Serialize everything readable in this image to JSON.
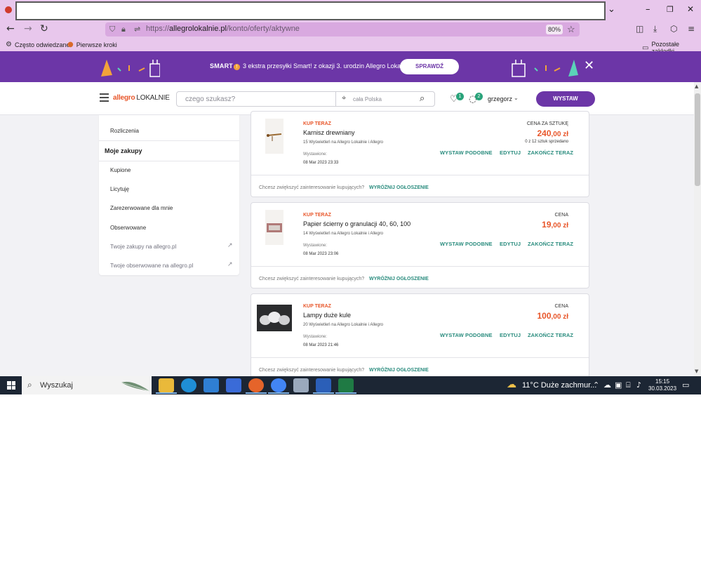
{
  "browser": {
    "url_prefix": "https://",
    "url_domain": "allegrolokalnie.pl",
    "url_path": "/konto/oferty/aktywne",
    "zoom": "80%",
    "bookmarks": [
      "Często odwiedzane",
      "Pierwsze kroki"
    ],
    "other_bookmarks": "Pozostałe zakładki",
    "window_controls": {
      "chevron": "⌄",
      "minimize": "–",
      "restore": "❐",
      "close": "✕"
    }
  },
  "promo": {
    "smart": "SMART",
    "excl": "!",
    "text": "3 ekstra przesyłki Smart! z okazji 3. urodzin Allegro Lokalnie!",
    "button": "SPRAWDŹ",
    "close": "✕"
  },
  "header": {
    "logo_allegro": "allegro",
    "logo_lokalnie": "LOKALNIE",
    "search_placeholder": "czego szukasz?",
    "location_placeholder": "cała Polska",
    "favorites_count": "1",
    "messages_count": "2",
    "username": "grzegorz",
    "sell_button": "WYSTAW"
  },
  "sidebar": {
    "items": [
      {
        "label": "Rozliczenia"
      },
      {
        "label": "Moje zakupy"
      },
      {
        "label": "Kupione"
      },
      {
        "label": "Licytuję"
      },
      {
        "label": "Zarezerwowane dla mnie"
      },
      {
        "label": "Obserwowane"
      },
      {
        "label": "Twoje zakupy na allegro.pl"
      },
      {
        "label": "Twoje obserwowane na allegro.pl"
      }
    ]
  },
  "offers": [
    {
      "type": "KUP TERAZ",
      "title": "Karnisz drewniany",
      "views": "15 Wyświetleń na Allegro Lokalnie i Allegro",
      "listed_label": "Wystawione:",
      "listed_date": "08 Mar 2023 23:33",
      "price_label": "CENA ZA SZTUKĘ",
      "price_int": "240",
      "price_dec": ",00",
      "currency": " zł",
      "sold": "0 z 12 sztuk sprzedano",
      "actions": [
        "WYSTAW PODOBNE",
        "EDYTUJ",
        "ZAKOŃCZ TERAZ"
      ],
      "promo_question": "Chcesz zwiększyć zainteresowanie kupujących?",
      "promo_link": "WYRÓŻNIJ OGŁOSZENIE"
    },
    {
      "type": "KUP TERAZ",
      "title": "Papier ścierny o granulacji 40, 60, 100",
      "views": "14 Wyświetleń na Allegro Lokalnie i Allegro",
      "listed_label": "Wystawione:",
      "listed_date": "08 Mar 2023 23:06",
      "price_label": "CENA",
      "price_int": "19",
      "price_dec": ",00",
      "currency": " zł",
      "actions": [
        "WYSTAW PODOBNE",
        "EDYTUJ",
        "ZAKOŃCZ TERAZ"
      ],
      "promo_question": "Chcesz zwiększyć zainteresowanie kupujących?",
      "promo_link": "WYRÓŻNIJ OGŁOSZENIE"
    },
    {
      "type": "KUP TERAZ",
      "title": "Lampy duże kule",
      "views": "20 Wyświetleń na Allegro Lokalnie i Allegro",
      "listed_label": "Wystawione:",
      "listed_date": "08 Mar 2023 21:46",
      "price_label": "CENA",
      "price_int": "100",
      "price_dec": ",00",
      "currency": " zł",
      "actions": [
        "WYSTAW PODOBNE",
        "EDYTUJ",
        "ZAKOŃCZ TERAZ"
      ],
      "promo_question": "Chcesz zwiększyć zainteresowanie kupujących?",
      "promo_link": "WYRÓŻNIJ OGŁOSZENIE"
    }
  ],
  "taskbar": {
    "search_text": "Wyszukaj",
    "weather": "11°C  Duże zachmur...",
    "time": "15:15",
    "date": "30.03.2023"
  },
  "colors": {
    "brand_orange": "#e8562a",
    "brand_purple": "#6c36a7",
    "action_teal": "#2a8c7e",
    "browser_chrome": "#e8c7ec"
  }
}
